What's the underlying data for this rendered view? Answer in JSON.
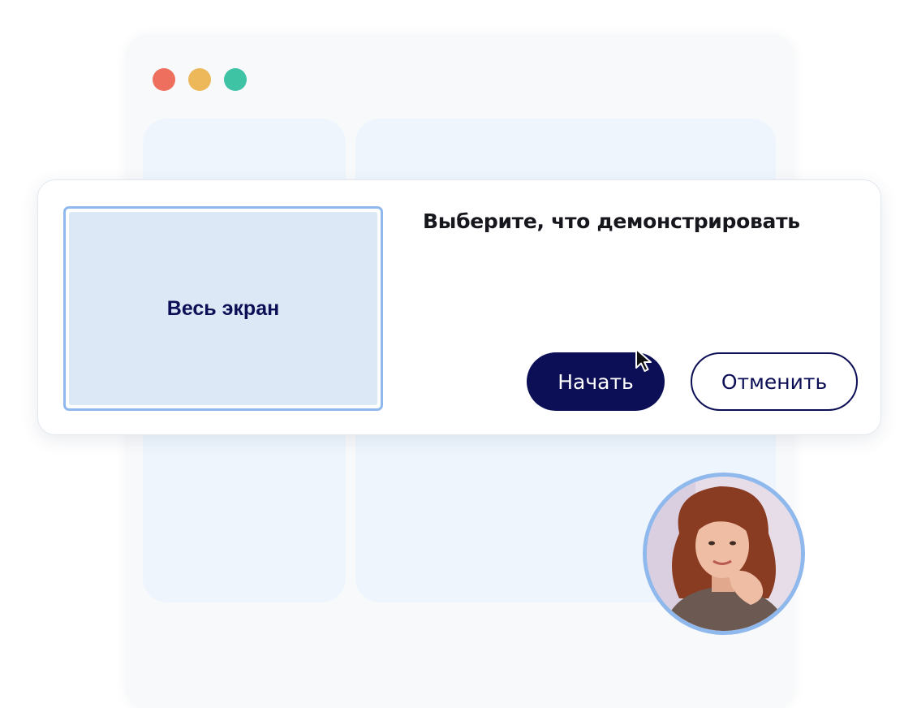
{
  "window": {
    "traffic_lights": {
      "close_color": "#ee6f5d",
      "minimize_color": "#ecb85a",
      "maximize_color": "#3fc3a5"
    }
  },
  "dialog": {
    "title": "Выберите, что демонстрировать",
    "options": [
      {
        "label": "Весь экран",
        "selected": true
      }
    ],
    "start_button": {
      "label": "Начать",
      "color": "#0c0f55"
    },
    "cancel_button": {
      "label": "Отменить"
    }
  },
  "icons": {
    "cursor": "mouse-pointer-icon",
    "participant": "participant-avatar"
  },
  "colors": {
    "accent": "#0c0f55",
    "selection_border": "#8fb8ec"
  }
}
